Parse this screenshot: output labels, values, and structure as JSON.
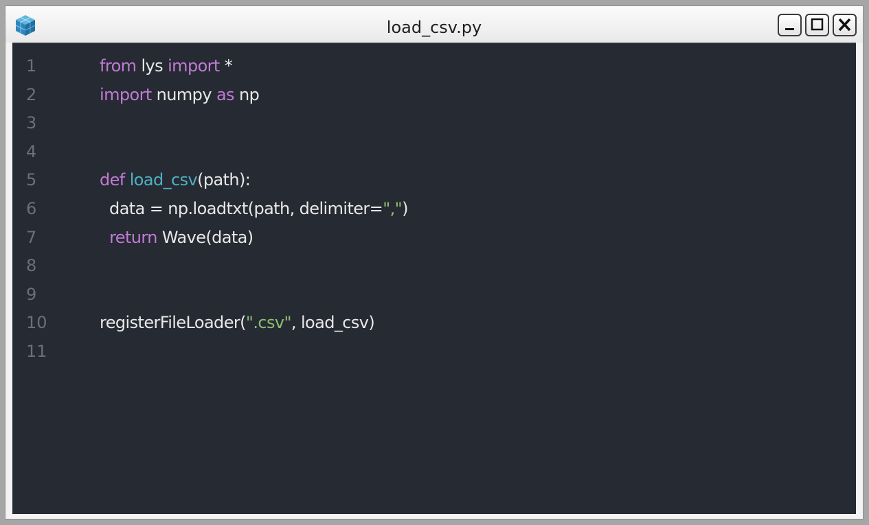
{
  "window": {
    "title": "load_csv.py",
    "app_icon": "cube-stack-icon",
    "buttons": [
      "minimize-icon",
      "maximize-icon",
      "close-icon"
    ]
  },
  "colors": {
    "editor_bg": "#262a33",
    "keyword": "#c07bd3",
    "function": "#4fb0c3",
    "string": "#8fbf6f",
    "text": "#e8e8e8",
    "line_number": "#6a707b"
  },
  "editor": {
    "lines": [
      {
        "num": "1",
        "tokens": [
          {
            "t": "from",
            "c": "kw"
          },
          {
            "t": " lys ",
            "c": ""
          },
          {
            "t": "import",
            "c": "kw"
          },
          {
            "t": " *",
            "c": ""
          }
        ]
      },
      {
        "num": "2",
        "tokens": [
          {
            "t": "import",
            "c": "kw"
          },
          {
            "t": " numpy ",
            "c": ""
          },
          {
            "t": "as",
            "c": "kw"
          },
          {
            "t": " np",
            "c": ""
          }
        ]
      },
      {
        "num": "3",
        "tokens": []
      },
      {
        "num": "4",
        "tokens": []
      },
      {
        "num": "5",
        "tokens": [
          {
            "t": "def",
            "c": "kw"
          },
          {
            "t": " ",
            "c": ""
          },
          {
            "t": "load_csv",
            "c": "fn"
          },
          {
            "t": "(path):",
            "c": ""
          }
        ]
      },
      {
        "num": "6",
        "tokens": [
          {
            "t": "  data = np.loadtxt(path, delimiter=",
            "c": ""
          },
          {
            "t": "\",\"",
            "c": "str"
          },
          {
            "t": ")",
            "c": ""
          }
        ]
      },
      {
        "num": "7",
        "tokens": [
          {
            "t": "  ",
            "c": ""
          },
          {
            "t": "return",
            "c": "kw"
          },
          {
            "t": " Wave(data)",
            "c": ""
          }
        ]
      },
      {
        "num": "8",
        "tokens": []
      },
      {
        "num": "9",
        "tokens": []
      },
      {
        "num": "10",
        "tokens": [
          {
            "t": "registerFileLoader(",
            "c": ""
          },
          {
            "t": "\".csv\"",
            "c": "str"
          },
          {
            "t": ", load_csv)",
            "c": ""
          }
        ]
      },
      {
        "num": "11",
        "tokens": []
      }
    ]
  }
}
